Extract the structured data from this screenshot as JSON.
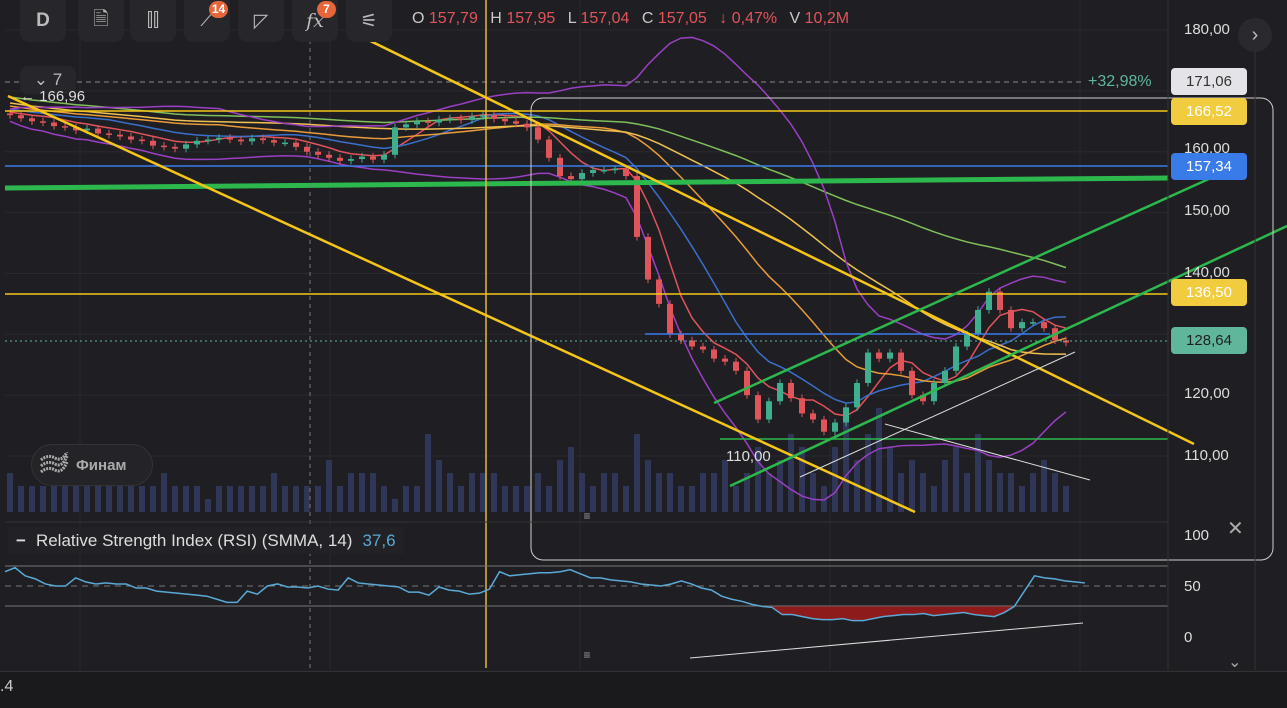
{
  "toolbar": {
    "interval": "D",
    "drawing_badge": "14",
    "indicator_badge": "7",
    "collapse_label": "7"
  },
  "ohlc": {
    "o_label": "O",
    "o": "157,79",
    "h_label": "H",
    "h": "157,95",
    "l_label": "L",
    "l": "157,04",
    "c_label": "C",
    "c": "157,05",
    "change": "↓ 0,47%",
    "v_label": "V",
    "v": "10,2M"
  },
  "price_axis": {
    "ticks": [
      "180,00",
      "160,00",
      "150,00",
      "140,00",
      "120,00",
      "110,00"
    ],
    "tags": {
      "measure": "171,06",
      "yellow_high": "166,52",
      "blue_level": "157,34",
      "yellow_low": "136,50",
      "last_price": "128,64"
    },
    "measure_pct": "+32,98%",
    "left_marker": "166,96",
    "low_label": "110,00"
  },
  "logo_text": "Финам",
  "rsi": {
    "title": "Relative Strength Index (RSI) (SMMA, 14)",
    "value": "37,6",
    "ticks": [
      "100",
      "50",
      "0"
    ]
  },
  "footer_text": ".4",
  "colors": {
    "up": "#3fae8f",
    "down": "#e0545a",
    "rsi": "#5aa9d6",
    "yellow": "#f5c518",
    "green": "#2db84d",
    "blue": "#3a7bea"
  },
  "chart_data": {
    "type": "candlestick",
    "price_range": [
      100,
      180
    ],
    "closes": [
      166,
      165.5,
      165,
      164.8,
      164.2,
      164,
      163.5,
      163.8,
      163,
      162.8,
      162.5,
      162,
      161.8,
      161,
      160.8,
      160.5,
      161.2,
      161.8,
      162,
      162.3,
      162,
      161.7,
      162.2,
      161.9,
      161.5,
      161.5,
      160.8,
      160,
      159.5,
      159,
      158.5,
      158.8,
      159.2,
      158.7,
      159.5,
      164,
      164.5,
      165,
      164.8,
      165.3,
      165.5,
      165.2,
      165.8,
      166,
      165.4,
      165,
      164.6,
      164,
      162,
      159,
      156,
      155.5,
      156.5,
      157,
      157,
      157.2,
      156,
      146,
      139,
      135,
      130,
      129,
      128,
      127.5,
      126,
      125.5,
      124,
      120,
      116,
      119,
      122,
      119.5,
      117,
      116,
      114,
      115.5,
      118,
      122,
      127,
      126,
      127,
      124,
      120,
      119,
      122,
      124,
      128,
      130,
      134,
      137,
      134,
      131,
      132,
      132,
      131,
      129,
      128.64
    ],
    "volumes": [
      3,
      2,
      2,
      2,
      2,
      2,
      4,
      2,
      3,
      2,
      2,
      2,
      2,
      2,
      3,
      2,
      2,
      2,
      1,
      2,
      2,
      2,
      2,
      2,
      3,
      2,
      2,
      2,
      2,
      4,
      2,
      3,
      3,
      3,
      2,
      1,
      2,
      2,
      6,
      4,
      3,
      2,
      3,
      3,
      3,
      2,
      2,
      2,
      3,
      2,
      4,
      5,
      3,
      2,
      3,
      3,
      2,
      6,
      4,
      3,
      3,
      2,
      2,
      3,
      3,
      4,
      2,
      3,
      5,
      3,
      4,
      6,
      5,
      3,
      2,
      5,
      7,
      4,
      6,
      8,
      5,
      3,
      4,
      3,
      2,
      4,
      5,
      3,
      6,
      4,
      3,
      3,
      2,
      3,
      4,
      3,
      2
    ],
    "rsi_range": [
      0,
      100
    ],
    "rsi_levels": [
      30,
      50,
      70
    ],
    "rsi": [
      64,
      68,
      60,
      57,
      52,
      50,
      50,
      58,
      54,
      52,
      53,
      52,
      52,
      48,
      48,
      45,
      44,
      43,
      42,
      41,
      40,
      37,
      34,
      34,
      45,
      42,
      50,
      52,
      49,
      49,
      48,
      50,
      47,
      46,
      58,
      53,
      52,
      51,
      50,
      49,
      44,
      44,
      41,
      49,
      46,
      45,
      42,
      43,
      47,
      64,
      60,
      61,
      62,
      63,
      63,
      64,
      66,
      62,
      58,
      58,
      56,
      55,
      54,
      52,
      51,
      50,
      52,
      55,
      52,
      48,
      46,
      40,
      37,
      35,
      32,
      30,
      29,
      22,
      22,
      20,
      18,
      17,
      17,
      18,
      16,
      16,
      18,
      20,
      21,
      22,
      22,
      23,
      21,
      22,
      23,
      24,
      22,
      21,
      20,
      24,
      30,
      45,
      60,
      58,
      57,
      55,
      54,
      53
    ]
  }
}
